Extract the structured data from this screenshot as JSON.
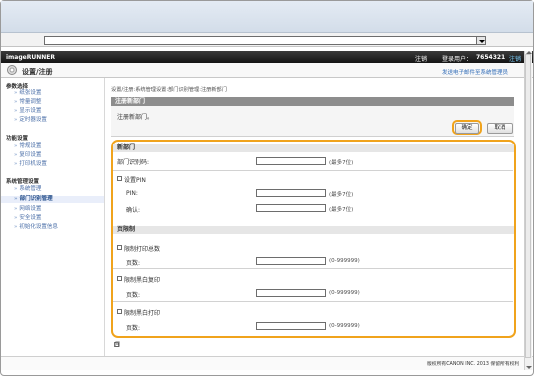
{
  "browser": {
    "address_value": "",
    "dropdown_icon": "chevron-down-icon"
  },
  "header": {
    "brand": "imageRUNNER",
    "logout_left": "注销",
    "login_label": "登录用户：",
    "login_name": "7654321",
    "logout_right": "注销"
  },
  "page": {
    "title": "设置/注册",
    "top_link": "发送电子邮件至系统管理员",
    "breadcrumb": "设置/注册:系统管理设置:部门识别管理:注册新部门"
  },
  "sidebar": {
    "groups": [
      {
        "title": "参数选择",
        "items": [
          "纸张设置",
          "常量调整",
          "显示设置",
          "定时器设置"
        ]
      },
      {
        "title": "功能设置",
        "items": [
          "常规设置",
          "复印设置",
          "打印机设置"
        ]
      },
      {
        "title": "系统管理设置",
        "items": [
          "系统管理",
          "部门识别管理",
          "网络设置",
          "安全设置",
          "初始化设置信息"
        ]
      }
    ]
  },
  "dialog": {
    "heading": "注册新部门",
    "message": "注册新部门。",
    "ok": "确定",
    "cancel": "取消"
  },
  "form": {
    "new_department": "新部门",
    "dept_id_label": "部门识别码:",
    "dept_id_value": "",
    "dept_id_hint": "(最多7位)",
    "pin_checkbox_label": "设置PIN",
    "pin_label": "PIN:",
    "pin_value": "",
    "pin_hint": "(最多7位)",
    "confirm_label": "确认:",
    "confirm_value": "",
    "confirm_hint": "(最多7位)",
    "page_limit": "页限制",
    "limits": [
      {
        "label": "限制打印总数",
        "pages_label": "页数:",
        "value": "",
        "hint": "(0-999999)"
      },
      {
        "label": "限制黑白复印",
        "pages_label": "页数:",
        "value": "",
        "hint": "(0-999999)"
      },
      {
        "label": "限制黑白打印",
        "pages_label": "页数:",
        "value": "",
        "hint": "(0-999999)"
      }
    ]
  },
  "footer": {
    "copyright": "版权所有CANON INC. 2013 保留所有权利",
    "bottom_mark": "回"
  }
}
